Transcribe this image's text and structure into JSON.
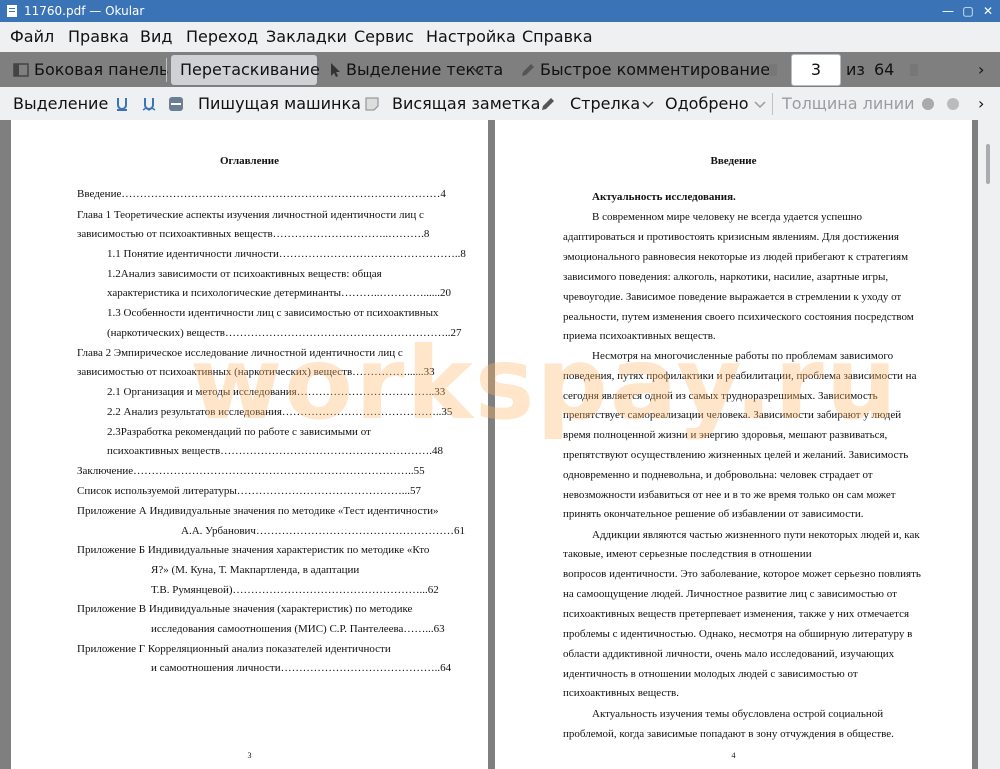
{
  "window": {
    "title": "11760.pdf — Okular",
    "close": "✕",
    "maximize": "▢",
    "minimize": "—"
  },
  "menu": [
    "Файл",
    "Правка",
    "Вид",
    "Переход",
    "Закладки",
    "Сервис",
    "Настройка",
    "Справка"
  ],
  "toolbar1": {
    "sidebar": "Боковая панель",
    "drag": "Перетаскивание",
    "text_select": "Выделение текста",
    "quick_comment": "Быстрое комментирование",
    "page": "3",
    "of": "из",
    "total": "64",
    "more": "›"
  },
  "toolbar2": {
    "select": "Выделение",
    "typewriter": "Пишущая машинка",
    "sticky": "Висящая заметка",
    "arrow": "Стрелка",
    "approved": "Одобрено",
    "line_width": "Толщина линии",
    "more": "›"
  },
  "watermark": "workspay.ru",
  "page_left": {
    "heading": "Оглавление",
    "lines": [
      "Введение……………………………………………………………………………4",
      "Глава 1 Теоретические аспекты изучения личностной идентичности лиц с",
      "зависимостью от психоактивных веществ…………………………..……….8",
      "1.1 Понятие идентичности личности…………………………………………..8",
      "1.2Анализ зависимости от психоактивных веществ: общая",
      "характеристика и психологические детерминанты………..…………......20",
      "1.3 Особенности идентичности лиц с зависимостью от психоактивных",
      "(наркотических) веществ……………………………………………………..27",
      "Глава 2 Эмпирическое исследование личностной идентичности лиц с",
      "зависимостью от психоактивных (наркотических) веществ……………......33",
      "2.1 Организация и методы исследования………………………………..33",
      "2.2 Анализ результатов исследования……………………………………..35",
      "2.3Разработка рекомендаций по работе с зависимыми от",
      "психоактивных веществ………………………………………………….48",
      "Заключение…………………………………………………………………..55",
      "Список используемой литературы………………………………………...57",
      "Приложение А Индивидуальные значения по методике «Тест идентичности»",
      "А.А. Урбанович………………………………………………61",
      "Приложение Б Индивидуальные значения характеристик по методике «Кто",
      "Я?» (М. Куна, Т. Макпартленда, в адаптации",
      "Т.В. Румянцевой)……………………………………………...62",
      "Приложение В Индивидуальные значения  (характеристик) по методике",
      "исследования самоотношения (МИС) С.Р. Пантелеева……...63",
      "Приложение Г Корреляционный анализ показателей идентичности",
      "и самоотношения личности……………………………………..64"
    ],
    "page_number": "3"
  },
  "page_right": {
    "heading": "Введение",
    "subheading": "Актуальность исследования.",
    "lines": [
      "В современном мире человеку не всегда удается успешно",
      "адаптироваться и противостоять кризисным явлениям. Для достижения",
      "эмоционального равновесия некоторые из людей прибегают к стратегиям",
      "зависимого поведения: алкоголь, наркотики, насилие, азартные игры,",
      "чревоугодие.  Зависимое поведение выражается в стремлении к уходу от",
      "реальности, путем изменения своего психического состояния посредством",
      "приема психоактивных веществ.",
      "Несмотря на многочисленные работы по проблемам зависимого",
      "поведения, путях профилактики и реабилитации, проблема зависимости на",
      "сегодня является одной из самых трудноразрешимых. Зависимость",
      "препятствует самореализации человека. Зависимости забирают у людей",
      "время полноценной жизни и энергию здоровья, мешают развиваться,",
      "препятствуют осуществлению жизненных целей и желаний. Зависимость",
      "одновременно и подневольна, и добровольна: человек страдает от",
      "невозможности избавиться от нее и в то же время только он сам может",
      "принять окончательное решение об избавлении от зависимости.",
      "Аддикции являются частью жизненного пути некоторых людей и, как",
      "таковые, имеют серьезные последствия в отношении",
      "вопросов идентичности. Это заболевание, которое может серьезно повлиять",
      "на самоощущение людей. Личностное развитие лиц с зависимостью от",
      "психоактивных веществ претерпевает изменения, также у них отмечается",
      "проблемы с идентичностью. Однако, несмотря на обширную литературу в",
      "области аддиктивной личности, очень мало исследований, изучающих",
      "идентичность в отношении молодых людей с зависимостью от",
      "психоактивных веществ.",
      "Актуальность изучения темы обусловлена острой социальной",
      "проблемой, когда зависимые попадают в зону отчуждения в обществе."
    ],
    "page_number": "4"
  }
}
